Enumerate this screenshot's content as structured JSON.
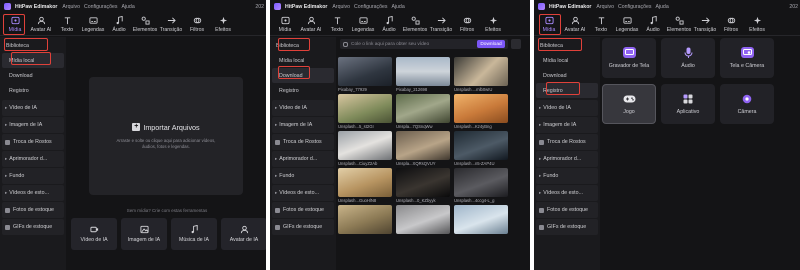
{
  "app": {
    "name": "HitPaw Edimakor"
  },
  "menu": [
    "Arquivo",
    "Configurações",
    "Ajuda"
  ],
  "titlebar_right": "202",
  "toolbar": [
    "Mídia",
    "Avatar AI",
    "Texto",
    "Legendas",
    "Áudio",
    "Elementos",
    "Transição",
    "Filtros",
    "Efeitos"
  ],
  "sidebar": {
    "library": "Biblioteca",
    "sub": [
      "Mídia local",
      "Download",
      "Registro"
    ],
    "sections": [
      "Vídeo de IA",
      "Imagem de IA",
      "Troca de Rostos",
      "Aprimorador d...",
      "Fundo",
      "Vídeos de esto...",
      "Fotos de estoque",
      "GIFs de estoque"
    ]
  },
  "panel1": {
    "import_title": "Importar Arquivos",
    "import_hint": "Arraste e solte ou clique aqui para adicionar vídeos, áudios, fotos e legendas.",
    "no_media": "Sem mídia? Crie com estas ferramentas",
    "ai_tools": [
      "Vídeo de IA",
      "Imagem de IA",
      "Música de IA",
      "Avatar de IA"
    ]
  },
  "panel2": {
    "search_placeholder": "Cole o link aqui para obter seu vídeo",
    "download_label": "Download",
    "thumbs": [
      "Pixabay_77929",
      "Pixabay_212698",
      "Unsplash....mlb0wIU",
      "Unsplash...5_st2GI",
      "Unspla...7QSnqWw",
      "Unsplash...Kz4yBng",
      "Unsplash...CiuyZ2Ab",
      "Unspla...XQRsQVUY",
      "Unsplash...n5-ZAP4U",
      "Unsplash...GuoHlN8",
      "Unsplash...0_KZbyyk",
      "Unsplash...4ccg4-L_g",
      "",
      "",
      ""
    ]
  },
  "panel3": {
    "tiles": [
      "Gravador de Tela",
      "Áudio",
      "Tela e Câmera",
      "Jogo",
      "Aplicativo",
      "Câmera"
    ]
  },
  "colors": {
    "accent": "#7b56f5",
    "highlight": "#e0413a",
    "bg": "#141416"
  }
}
